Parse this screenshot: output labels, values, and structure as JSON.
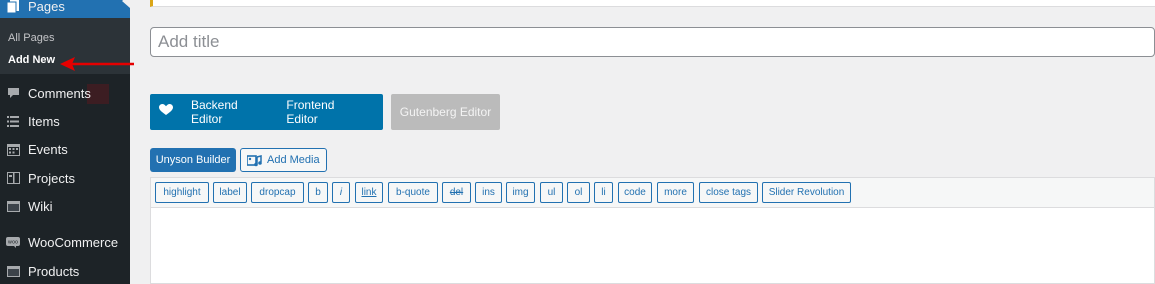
{
  "sidebar": {
    "current": {
      "label": "Pages",
      "icon": "pages-icon"
    },
    "submenu": [
      {
        "label": "All Pages",
        "active": false
      },
      {
        "label": "Add New",
        "active": true
      }
    ],
    "items": [
      {
        "label": "Comments",
        "icon": "comments-icon"
      },
      {
        "label": "Items",
        "icon": "list-icon"
      },
      {
        "label": "Events",
        "icon": "calendar-icon"
      },
      {
        "label": "Projects",
        "icon": "projects-icon"
      },
      {
        "label": "Wiki",
        "icon": "wiki-icon"
      },
      {
        "label": "WooCommerce",
        "icon": "woocommerce-icon"
      },
      {
        "label": "Products",
        "icon": "products-icon"
      }
    ]
  },
  "editor": {
    "title_placeholder": "Add title",
    "switch": {
      "backend": "Backend Editor",
      "frontend": "Frontend Editor",
      "gutenberg": "Gutenberg Editor"
    },
    "unyson_builder": "Unyson Builder",
    "add_media": "Add Media",
    "quicktags": [
      "highlight",
      "label",
      "dropcap",
      "b",
      "i",
      "link",
      "b-quote",
      "del",
      "ins",
      "img",
      "ul",
      "ol",
      "li",
      "code",
      "more",
      "close tags",
      "Slider Revolution"
    ]
  },
  "colors": {
    "sidebar_bg": "#1d2327",
    "accent": "#2271b1",
    "wpbakery_blue": "#0073aa",
    "annotation_arrow": "#e60000"
  }
}
